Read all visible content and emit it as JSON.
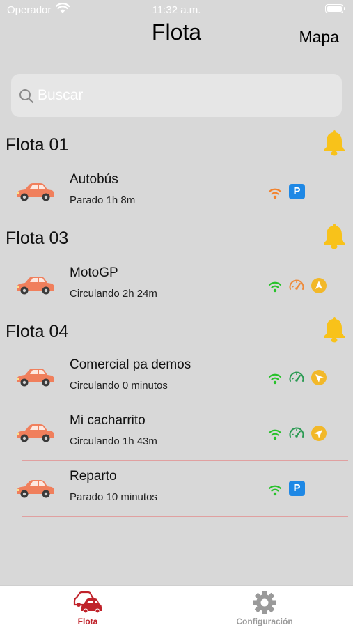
{
  "status_bar": {
    "carrier": "Operador",
    "time": "11:32 a.m."
  },
  "nav": {
    "title": "Flota",
    "map_button": "Mapa"
  },
  "search": {
    "placeholder": "Buscar",
    "value": ""
  },
  "colors": {
    "car": "#f07f5c",
    "bell": "#f8c21a",
    "wifi_green": "#27c22a",
    "wifi_orange": "#f3822c",
    "parking_badge": "#1e88e5",
    "speed_green": "#2a9a52",
    "speed_orange": "#ee8a3a",
    "nav_badge": "#f2b829",
    "tab_active": "#c0232b",
    "tab_inactive": "#9a9a9a"
  },
  "fleets": [
    {
      "name": "Flota 01",
      "icon": "bell-icon",
      "vehicles": [
        {
          "name": "Autobús",
          "status": "Parado 1h 8m",
          "icons": [
            "wifi-orange-icon",
            "parking-badge-icon"
          ]
        }
      ]
    },
    {
      "name": "Flota 03",
      "icon": "bell-icon",
      "vehicles": [
        {
          "name": "MotoGP",
          "status": "Circulando 2h 24m",
          "icons": [
            "wifi-green-icon",
            "speedometer-orange-icon",
            "navigation-badge-icon"
          ]
        }
      ]
    },
    {
      "name": "Flota 04",
      "icon": "bell-icon",
      "vehicles": [
        {
          "name": "Comercial pa demos",
          "status": "Circulando 0 minutos",
          "icons": [
            "wifi-green-icon",
            "speedometer-green-icon",
            "navigation-badge-icon"
          ]
        },
        {
          "name": "Mi cacharrito",
          "status": "Circulando 1h 43m",
          "icons": [
            "wifi-green-icon",
            "speedometer-green-icon",
            "navigation-badge-icon"
          ]
        },
        {
          "name": "Reparto",
          "status": "Parado 10 minutos",
          "icons": [
            "wifi-green-icon",
            "parking-badge-icon"
          ]
        }
      ]
    }
  ],
  "badges": {
    "parking": "P"
  },
  "tabbar": {
    "tabs": [
      {
        "label": "Flota",
        "icon": "cars-icon",
        "active": true
      },
      {
        "label": "Configuración",
        "icon": "gear-icon",
        "active": false
      }
    ]
  }
}
